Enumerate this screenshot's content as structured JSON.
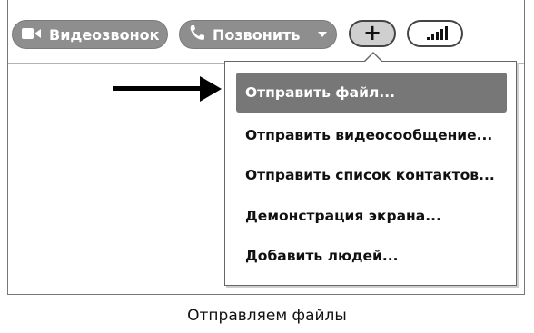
{
  "toolbar": {
    "video_call_label": "Видеозвонок",
    "call_label": "Позвонить",
    "add_symbol": "+",
    "icons": {
      "video": "video-camera-icon",
      "phone": "phone-handset-icon",
      "dropdown": "chevron-down-icon",
      "signal": "signal-strength-icon"
    }
  },
  "menu": {
    "items": [
      {
        "label": "Отправить файл...",
        "highlighted": true
      },
      {
        "label": "Отправить видеосообщение...",
        "highlighted": false
      },
      {
        "label": "Отправить список контактов...",
        "highlighted": false
      },
      {
        "label": "Демонстрация экрана...",
        "highlighted": false
      },
      {
        "label": "Добавить людей...",
        "highlighted": false
      }
    ]
  },
  "caption": "Отправляем файлы",
  "colors": {
    "pill_bg": "#8e8e8e",
    "highlight_bg": "#777777",
    "arrow": "#000000"
  }
}
